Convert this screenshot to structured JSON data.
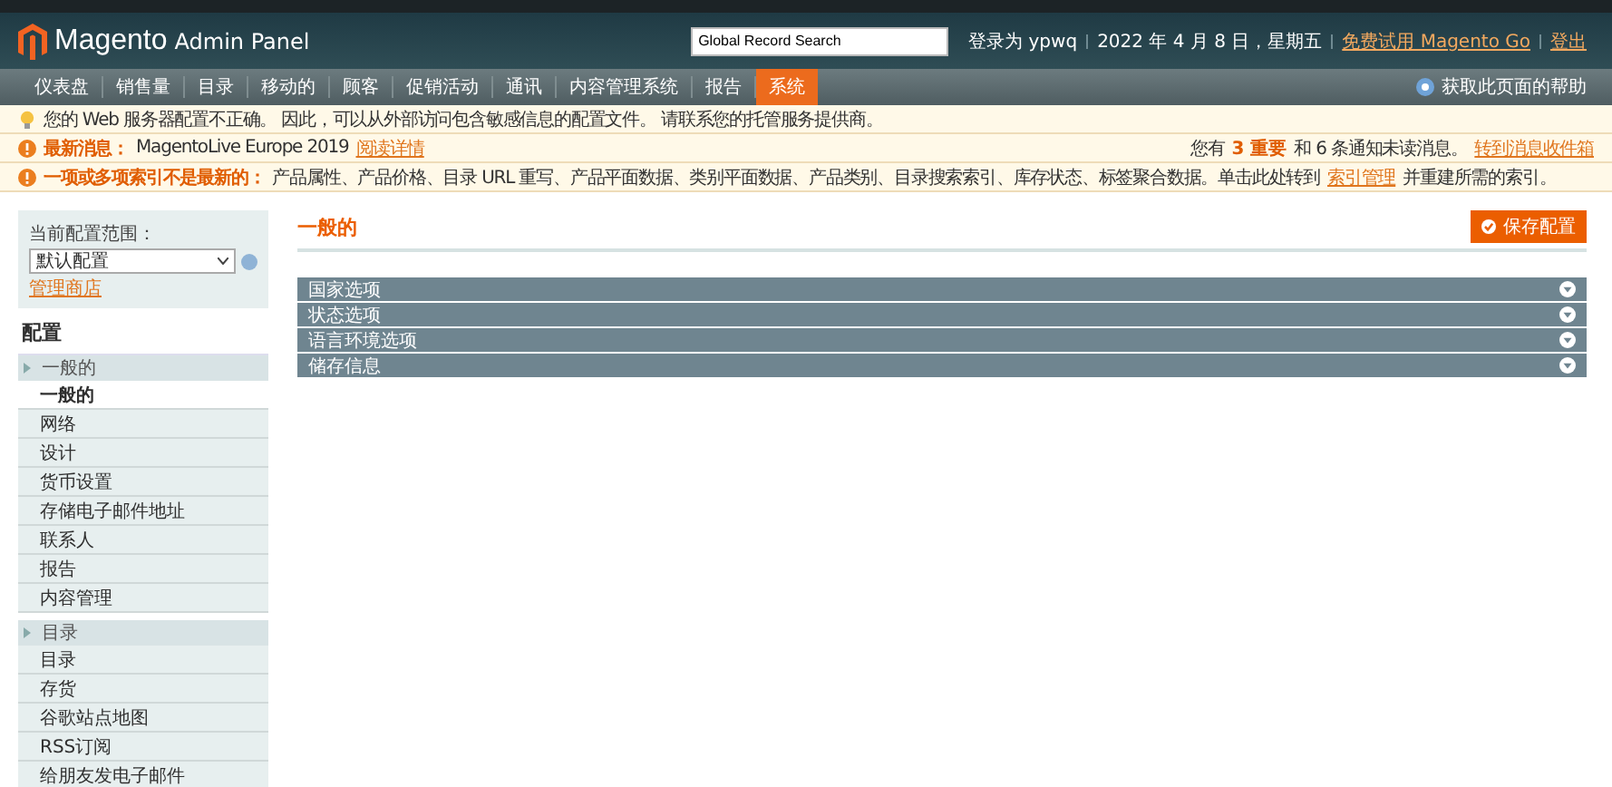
{
  "header": {
    "logo_text": "Magento",
    "logo_suffix": "Admin Panel",
    "search": {
      "value": "Global Record Search"
    },
    "user": "登录为 ypwq",
    "date": "2022 年 4 月 8 日，星期五",
    "links": [
      "免费试用 Magento Go",
      "登出"
    ]
  },
  "nav": {
    "items": [
      {
        "label": "仪表盘",
        "selected": false
      },
      {
        "label": "销售量",
        "selected": false
      },
      {
        "label": "目录",
        "selected": false
      },
      {
        "label": "移动的",
        "selected": false
      },
      {
        "label": "顾客",
        "selected": false
      },
      {
        "label": "促销活动",
        "selected": false
      },
      {
        "label": "通讯",
        "selected": false
      },
      {
        "label": "内容管理系统",
        "selected": false
      },
      {
        "label": "报告",
        "selected": false
      },
      {
        "label": "系统",
        "selected": true
      }
    ],
    "help": "获取此页面的帮助"
  },
  "notices": [
    {
      "kind": "tip",
      "text": "您的 Web 服务器配置不正确。 因此，可以从外部访问包含敏感信息的配置文件。 请联系您的托管服务提供商。"
    },
    {
      "kind": "news",
      "label": "最新消息：",
      "text": "MagentoLive Europe 2019",
      "link": "阅读详情",
      "unread_prefix": "您有",
      "important": "3 重要",
      "unread_suffix": "和 6 条通知未读消息。",
      "inbox_link": "转到消息收件箱"
    },
    {
      "kind": "index",
      "label": "一项或多项索引不是最新的：",
      "text": "产品属性、产品价格、目录 URL 重写、产品平面数据、类别平面数据、产品类别、目录搜索索引、库存状态、标签聚合数据。单击此处转到",
      "link": "索引管理",
      "after": "并重建所需的索引。"
    }
  ],
  "sidebar": {
    "scope_label": "当前配置范围：",
    "scope_value": "默认配置",
    "manage_link": "管理商店",
    "heading": "配置",
    "groups": [
      {
        "title": "一般的",
        "items": [
          {
            "label": "一般的",
            "selected": true
          },
          {
            "label": "网络",
            "selected": false
          },
          {
            "label": "设计",
            "selected": false
          },
          {
            "label": "货币设置",
            "selected": false
          },
          {
            "label": "存储电子邮件地址",
            "selected": false
          },
          {
            "label": "联系人",
            "selected": false
          },
          {
            "label": "报告",
            "selected": false
          },
          {
            "label": "内容管理",
            "selected": false
          }
        ]
      },
      {
        "title": "目录",
        "items": [
          {
            "label": "目录",
            "selected": false
          },
          {
            "label": "存货",
            "selected": false
          },
          {
            "label": "谷歌站点地图",
            "selected": false
          },
          {
            "label": "RSS订阅",
            "selected": false
          },
          {
            "label": "给朋友发电子邮件",
            "selected": false
          }
        ]
      }
    ]
  },
  "content": {
    "title": "一般的",
    "save_button": "保存配置",
    "sections": [
      "国家选项",
      "状态选项",
      "语言环境选项",
      "储存信息"
    ]
  }
}
